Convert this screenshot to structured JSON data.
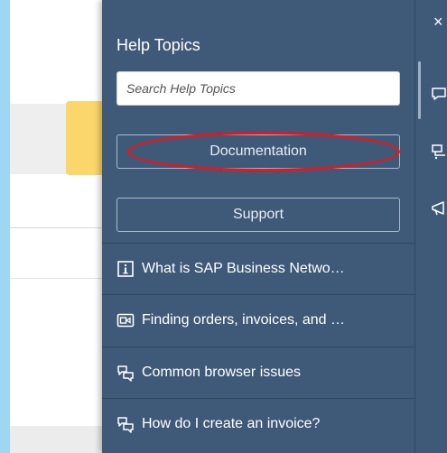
{
  "panel": {
    "title": "Help Topics",
    "search_placeholder": "Search Help Topics",
    "buttons": {
      "documentation": "Documentation",
      "support": "Support"
    },
    "topics": [
      {
        "icon": "info-icon",
        "label": "What is SAP Business Netwo…"
      },
      {
        "icon": "video-icon",
        "label": "Finding orders, invoices, and …"
      },
      {
        "icon": "chat-bubbles-icon",
        "label": "Common browser issues"
      },
      {
        "icon": "chat-bubbles-icon",
        "label": "How do I create an invoice?"
      }
    ]
  },
  "rail": {
    "close_label": "×",
    "icons": [
      "feedback-icon",
      "community-icon",
      "announcement-icon"
    ]
  },
  "colors": {
    "panel_bg": "#3f5a78",
    "highlight": "#e3171d",
    "page_bg": "#9fd6f3"
  }
}
